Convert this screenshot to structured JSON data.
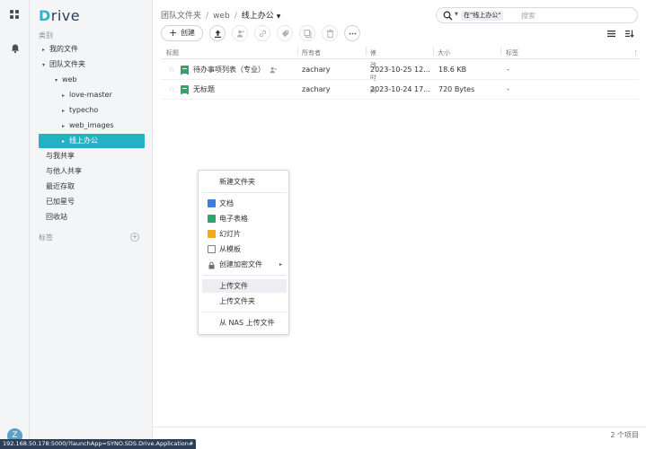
{
  "app": {
    "logo_initial": "D",
    "logo_rest": "rive"
  },
  "sidebar": {
    "category_header": "类别",
    "items": [
      {
        "label": "我的文件",
        "caret": "▸"
      },
      {
        "label": "团队文件夹",
        "caret": "▾"
      },
      {
        "label": "web",
        "caret": "▾"
      },
      {
        "label": "love-master",
        "caret": "▸"
      },
      {
        "label": "typecho",
        "caret": "▸"
      },
      {
        "label": "web_images",
        "caret": "▸"
      },
      {
        "label": "线上办公",
        "caret": "▸"
      }
    ],
    "links": [
      "与我共享",
      "与他人共享",
      "最近存取",
      "已加星号",
      "回收站"
    ],
    "tags_header": "标签",
    "tags_add": "+"
  },
  "breadcrumb": {
    "root": "团队文件夹",
    "mid": "web",
    "current": "线上办公",
    "sep": "/"
  },
  "search": {
    "scope": "在\"线上办公\"",
    "placeholder": "搜索"
  },
  "toolbar": {
    "create_label": "创建",
    "create_plus": "+"
  },
  "table": {
    "headers": {
      "title": "标题",
      "owner": "所有者",
      "modified": "修改时间",
      "size": "大小",
      "tags": "标签",
      "sort_mark": "▾",
      "more": "⋮"
    },
    "rows": [
      {
        "name": "待办事项列表（专业）",
        "owner": "zachary",
        "modified": "2023-10-25 12...",
        "size": "18.6 KB",
        "tags": "-",
        "shared": true
      },
      {
        "name": "无标题",
        "owner": "zachary",
        "modified": "2023-10-24 17...",
        "size": "720 Bytes",
        "tags": "-",
        "shared": false
      }
    ]
  },
  "footer": {
    "count": "2 个项目"
  },
  "context_menu": {
    "items": [
      {
        "label": "新建文件夹",
        "icon": "none"
      },
      {
        "label": "文档",
        "icon": "doc-icon",
        "color": "#3b7ddd"
      },
      {
        "label": "电子表格",
        "icon": "sheet-icon",
        "color": "#2fa56a"
      },
      {
        "label": "幻灯片",
        "icon": "slides-icon",
        "color": "#f0a81c"
      },
      {
        "label": "从模板",
        "icon": "template-icon",
        "color": "#7a7f86"
      },
      {
        "label": "创建加密文件",
        "icon": "lock-icon",
        "color": "#6b7077",
        "submenu": "▸"
      },
      {
        "label": "上传文件",
        "icon": "none"
      },
      {
        "label": "上传文件夹",
        "icon": "none"
      },
      {
        "label": "从 NAS 上传文件",
        "icon": "none"
      }
    ]
  },
  "status_bar": {
    "url": "192.168.50.178:5000/?launchApp=SYNO.SDS.Drive.Application#"
  },
  "user": {
    "avatar_letter": "Z"
  },
  "colors": {
    "accent": "#24b2c3",
    "navy": "#2c3f57"
  }
}
